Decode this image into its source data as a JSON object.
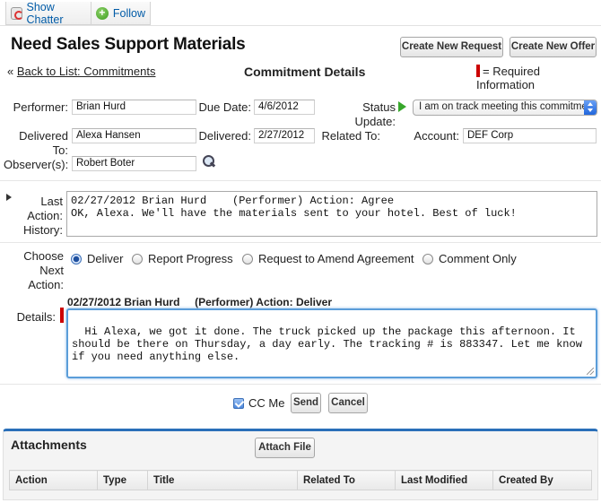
{
  "chatter": {
    "show_label": "Show Chatter",
    "follow_label": "Follow"
  },
  "page_title": "Need Sales Support Materials",
  "buttons": {
    "new_request": "Create New Request",
    "new_offer": "Create New Offer",
    "attach_file": "Attach File",
    "send": "Send",
    "cancel": "Cancel"
  },
  "back_link": "Back to List: Commitments",
  "back_prefix": "«",
  "section_title": "Commitment Details",
  "required_note": "= Required Information",
  "fields": {
    "performer_label": "Performer:",
    "performer_value": "Brian Hurd",
    "due_date_label": "Due Date:",
    "due_date_value": "4/6/2012",
    "status_label": "Status Update:",
    "status_value": "I am on track meeting this commitme",
    "delivered_to_label": "Delivered To:",
    "delivered_to_value": "Alexa Hansen",
    "delivered_label": "Delivered:",
    "delivered_value": "2/27/2012",
    "related_to_label": "Related To:",
    "account_label": "Account:",
    "account_value": "DEF Corp",
    "observers_label": "Observer(s):",
    "observers_value": "Robert Boter"
  },
  "history": {
    "label": "Last Action: History:",
    "text": "02/27/2012 Brian Hurd    (Performer) Action: Agree\nOK, Alexa. We'll have the materials sent to your hotel. Best of luck!"
  },
  "next_action": {
    "label": "Choose Next Action:",
    "options": [
      "Deliver",
      "Report Progress",
      "Request to Amend Agreement",
      "Comment Only"
    ],
    "selected": "Deliver"
  },
  "details": {
    "heading": "02/27/2012 Brian Hurd     (Performer) Action: Deliver",
    "label": "Details:",
    "text": "Hi Alexa, we got it done. The truck picked up the package this afternoon. It should be there on Thursday, a day early. The tracking # is 883347. Let me know if you need anything else."
  },
  "cc_me": {
    "label": "CC Me",
    "checked": true
  },
  "attachments": {
    "title": "Attachments",
    "columns": [
      "Action",
      "Type",
      "Title",
      "Related To",
      "Last Modified",
      "Created By"
    ]
  },
  "colors": {
    "accent": "#2a6fb9",
    "required": "#cc0000",
    "link": "#015ba7"
  }
}
